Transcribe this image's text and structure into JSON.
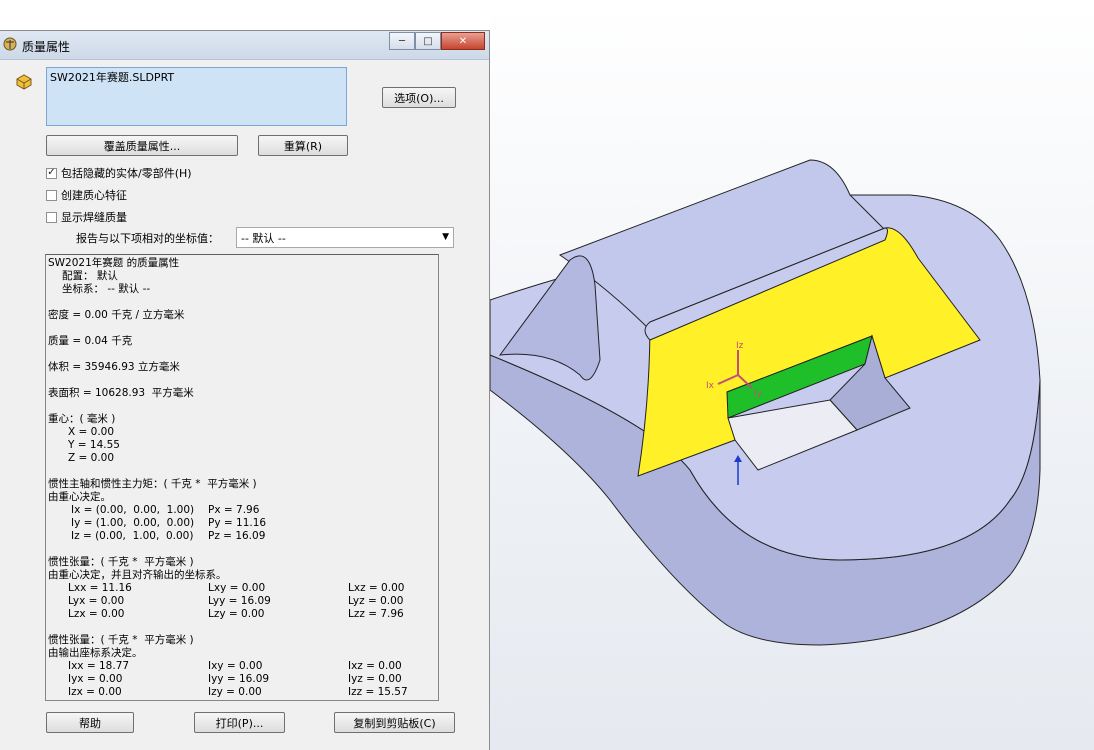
{
  "dialog": {
    "title": "质量属性",
    "file_name": "SW2021年赛题.SLDPRT",
    "options_button": "选项(O)...",
    "override_button": "覆盖质量属性...",
    "recalc_button": "重算(R)",
    "checkboxes": [
      {
        "label": "包括隐藏的实体/零部件(H)",
        "checked": true
      },
      {
        "label": "创建质心特征",
        "checked": false
      },
      {
        "label": "显示焊缝质量",
        "checked": false
      }
    ],
    "report_label": "报告与以下项相对的坐标值：",
    "coord_select": "-- 默认 --",
    "help_button": "帮助",
    "print_button": "打印(P)...",
    "copy_button": "复制到剪贴板(C)"
  },
  "results": {
    "header": "SW2021年赛题 的质量属性",
    "config": "配置： 默认",
    "coord_sys": "坐标系： -- 默认 --",
    "density": "密度 = 0.00 千克 / 立方毫米",
    "mass": "质量 = 0.04 千克",
    "volume": "体积 = 35946.93 立方毫米",
    "surface": "表面积 = 10628.93  平方毫米",
    "cog_title": "重心：( 毫米 )",
    "cog_x": "X = 0.00",
    "cog_y": "Y = 14.55",
    "cog_z": "Z = 0.00",
    "principal_title": "惯性主轴和惯性主力矩：( 千克 *  平方毫米 )",
    "principal_sub": "由重心决定。",
    "ix": "Ix = (0.00,  0.00,  1.00)",
    "px": "Px = 7.96",
    "iy": "Iy = (1.00,  0.00,  0.00)",
    "py": "Py = 11.16",
    "iz": "Iz = (0.00,  1.00,  0.00)",
    "pz": "Pz = 16.09",
    "tensor1_title": "惯性张量：( 千克 *  平方毫米 )",
    "tensor1_sub": "由重心决定，并且对齐输出的坐标系。",
    "lxx": "Lxx = 11.16",
    "lxy": "Lxy = 0.00",
    "lxz": "Lxz = 0.00",
    "lyx": "Lyx = 0.00",
    "lyy": "Lyy = 16.09",
    "lyz": "Lyz = 0.00",
    "lzx": "Lzx = 0.00",
    "lzy": "Lzy = 0.00",
    "lzz": "Lzz = 7.96",
    "tensor2_title": "惯性张量：( 千克 *  平方毫米 )",
    "tensor2_sub": "由输出座标系决定。",
    "ixx": "Ixx = 18.77",
    "ixy": "Ixy = 0.00",
    "ixz": "Ixz = 0.00",
    "iyx": "Iyx = 0.00",
    "iyy": "Iyy = 16.09",
    "iyz": "Iyz = 0.00",
    "izx": "Izx = 0.00",
    "izy": "Izy = 0.00",
    "izz": "Izz = 15.57"
  },
  "viewport": {
    "triad_z": "Iz",
    "triad_x": "Ix",
    "triad_y": "Iy",
    "colors": {
      "body": "#c7cbee",
      "face": "#fff027",
      "green": "#1fbf2a"
    }
  }
}
